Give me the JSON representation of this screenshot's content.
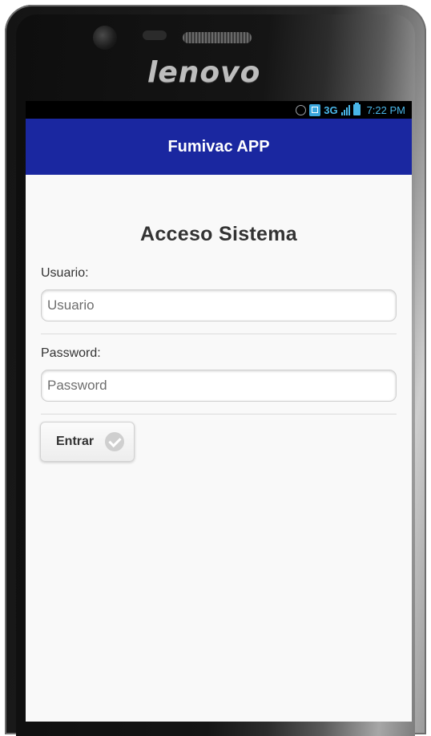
{
  "device": {
    "brand": "lenovo"
  },
  "status_bar": {
    "network": "3G",
    "time": "7:22 PM"
  },
  "app_bar": {
    "title": "Fumivac APP"
  },
  "form": {
    "title": "Acceso Sistema",
    "username": {
      "label": "Usuario:",
      "placeholder": "Usuario",
      "value": ""
    },
    "password": {
      "label": "Password:",
      "placeholder": "Password",
      "value": ""
    },
    "submit_label": "Entrar"
  },
  "colors": {
    "app_bar": "#1a27a0",
    "status_accent": "#49b6e8",
    "background": "#f9f9f9"
  }
}
